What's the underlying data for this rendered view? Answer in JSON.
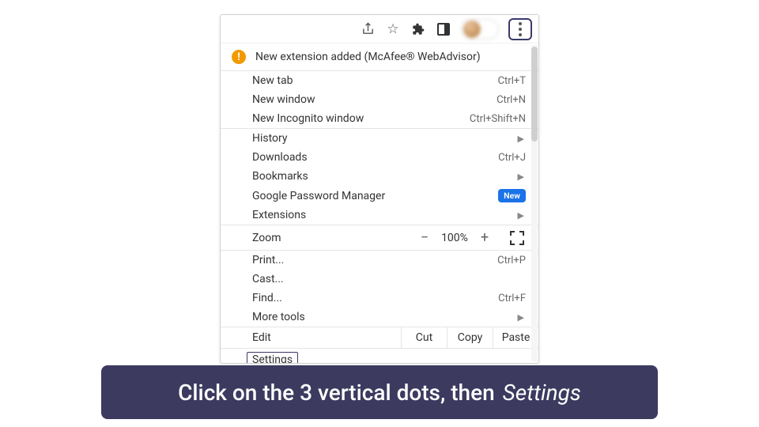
{
  "notice": {
    "text": "New extension added (McAfee® WebAdvisor)"
  },
  "group1": [
    {
      "label": "New tab",
      "shortcut": "Ctrl+T"
    },
    {
      "label": "New window",
      "shortcut": "Ctrl+N"
    },
    {
      "label": "New Incognito window",
      "shortcut": "Ctrl+Shift+N"
    }
  ],
  "group2": [
    {
      "label": "History",
      "submenu": true
    },
    {
      "label": "Downloads",
      "shortcut": "Ctrl+J"
    },
    {
      "label": "Bookmarks",
      "submenu": true
    },
    {
      "label": "Google Password Manager",
      "badge": "New"
    },
    {
      "label": "Extensions",
      "submenu": true
    }
  ],
  "zoom": {
    "label": "Zoom",
    "minus": "−",
    "value": "100%",
    "plus": "+"
  },
  "group3": [
    {
      "label": "Print...",
      "shortcut": "Ctrl+P"
    },
    {
      "label": "Cast..."
    },
    {
      "label": "Find...",
      "shortcut": "Ctrl+F"
    },
    {
      "label": "More tools",
      "submenu": true
    }
  ],
  "edit": {
    "label": "Edit",
    "cut": "Cut",
    "copy": "Copy",
    "paste": "Paste"
  },
  "settings": {
    "label": "Settings"
  },
  "caption": {
    "prefix": "Click on the 3 vertical dots, then",
    "emph": "Settings"
  }
}
